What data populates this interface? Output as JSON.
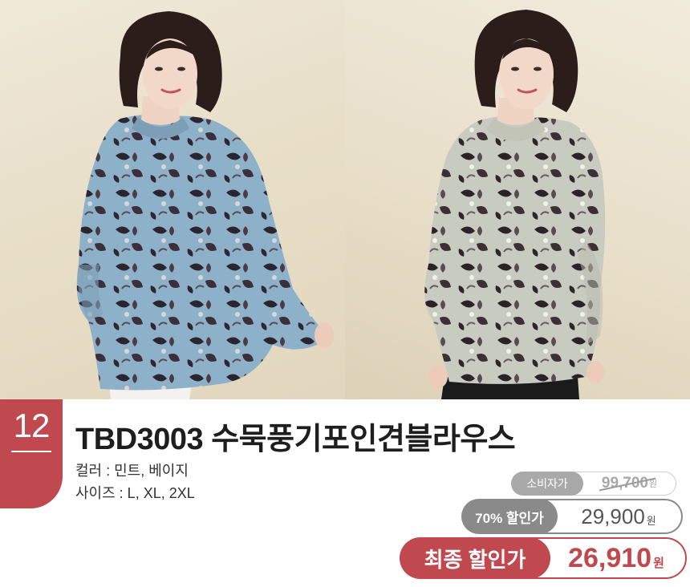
{
  "product": {
    "number": "12",
    "title": "TBD3003  수묵풍기포인견블라우스",
    "color_option": "컬러 : 민트, 베이지",
    "size_option": "사이즈 : L, XL, 2XL"
  },
  "prices": {
    "consumer": {
      "label": "소비자가",
      "value": "99,700",
      "unit": "원"
    },
    "discount": {
      "label": "70% 할인가",
      "value": "29,900",
      "unit": "원"
    },
    "final": {
      "label": "최종 할인가",
      "value": "26,910",
      "unit": "원"
    }
  },
  "photos": {
    "left": {
      "subject": "model-wearing-mint-floral-blouse",
      "blouse_color": "#8fb0c6"
    },
    "right": {
      "subject": "model-wearing-beige-floral-blouse",
      "blouse_color": "#c9cbc0"
    }
  },
  "colors": {
    "accent": "#c0484f",
    "discount_gray": "#8a8a8a",
    "consumer_gray": "#a9a9a9"
  }
}
